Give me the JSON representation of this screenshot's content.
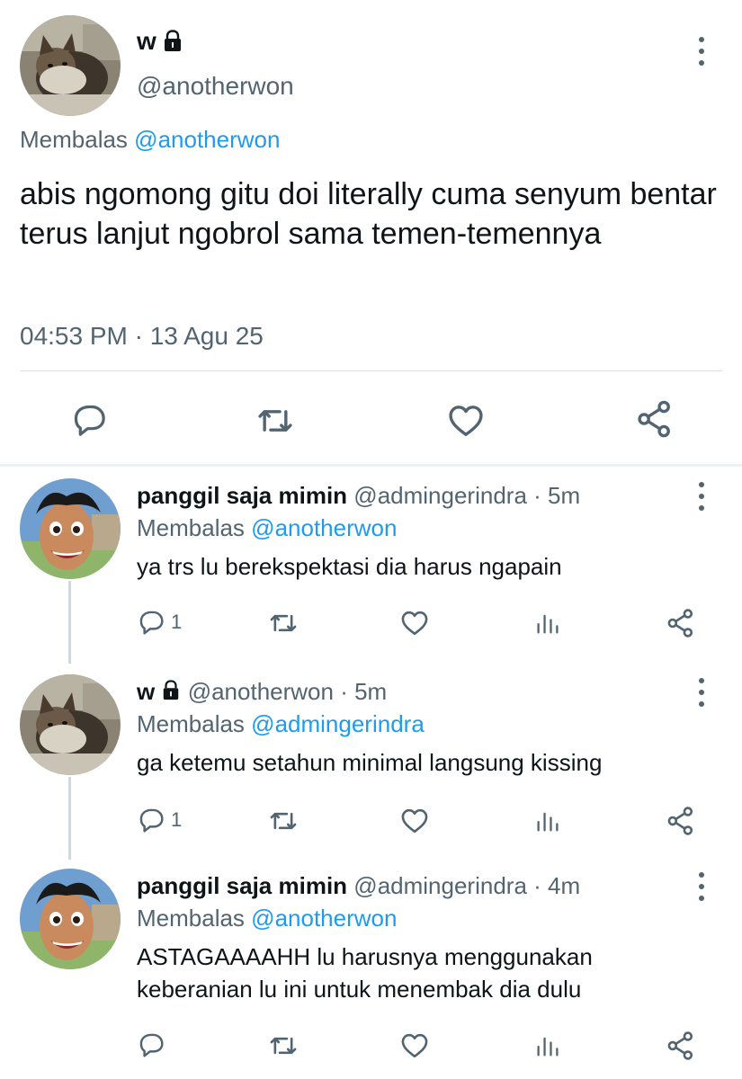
{
  "colors": {
    "accent": "#1d9bf0",
    "muted": "#536471",
    "text": "#0f1419"
  },
  "main_tweet": {
    "name": "w",
    "handle": "@anotherwon",
    "reply_prefix": "Membalas",
    "reply_to": "@anotherwon",
    "text": "abis ngomong gitu doi literally cuma senyum bentar terus lanjut ngobrol sama temen-temennya",
    "timestamp": "04:53 PM · 13 Agu 25",
    "icons": [
      "reply-icon",
      "retweet-icon",
      "like-icon",
      "share-icon"
    ]
  },
  "replies": [
    {
      "name": "panggil saja mimin",
      "handle": "@admingerindra",
      "time": "· 5m",
      "reply_prefix": "Membalas",
      "reply_to": "@anotherwon",
      "text": "ya trs lu berekspektasi dia harus ngapain",
      "reply_count": "1",
      "avatar": "cartoon-face-avatar"
    },
    {
      "name": "w",
      "handle": "@anotherwon",
      "time": "· 5m",
      "reply_prefix": "Membalas",
      "reply_to": "@admingerindra",
      "text": "ga ketemu setahun minimal langsung kissing",
      "reply_count": "1",
      "avatar": "cat-avatar"
    },
    {
      "name": "panggil saja mimin",
      "handle": "@admingerindra",
      "time": "· 4m",
      "reply_prefix": "Membalas",
      "reply_to": "@anotherwon",
      "text": "ASTAGAAAAHH lu harusnya menggunakan keberanian lu ini untuk menembak dia dulu",
      "reply_count": "",
      "avatar": "cartoon-face-avatar"
    }
  ]
}
